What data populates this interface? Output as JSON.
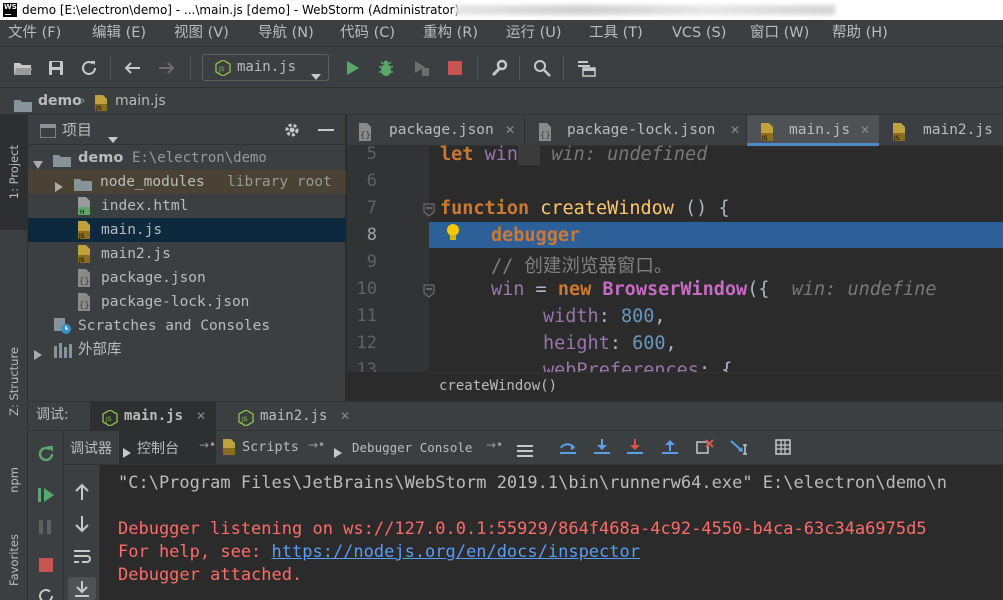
{
  "window": {
    "title": "demo [E:\\electron\\demo] - ...\\main.js [demo] - WebStorm (Administrator)",
    "app_icon": "WS"
  },
  "menu": [
    "文件 (F)",
    "编辑 (E)",
    "视图 (V)",
    "导航 (N)",
    "代码 (C)",
    "重构 (R)",
    "运行 (U)",
    "工具 (T)",
    "VCS (S)",
    "窗口 (W)",
    "帮助 (H)"
  ],
  "toolbar": {
    "run_config": "main.js"
  },
  "navbar": {
    "project": "demo",
    "file": "main.js"
  },
  "side_tabs": {
    "project": "1: Project",
    "structure": "Z: Structure",
    "npm": "npm",
    "favorites": "Favorites"
  },
  "project_panel": {
    "title": "项目",
    "root": {
      "name": "demo",
      "path": "E:\\electron\\demo"
    },
    "node_modules": {
      "name": "node_modules",
      "note": "library root"
    },
    "files": [
      "index.html",
      "main.js",
      "main2.js",
      "package.json",
      "package-lock.json"
    ],
    "scratches": "Scratches and Consoles",
    "external": "外部库"
  },
  "editor": {
    "tabs": [
      "package.json",
      "package-lock.json",
      "main.js",
      "main2.js"
    ],
    "lines": {
      "n5": "5",
      "n6": "6",
      "n7": "7",
      "n8": "8",
      "n9": "9",
      "n10": "10",
      "n11": "11",
      "n12": "12",
      "n13": "13"
    },
    "code": {
      "l5_kw": "let",
      "l5_var": "win",
      "l5_hint": "win: undefined",
      "l7_kw": "function",
      "l7_fn": "createWindow",
      "l7_rest": " () {",
      "l8_kw": "debugger",
      "l9_comment": "// 创建浏览器窗口。",
      "l10_var": "win",
      "l10_op": " = ",
      "l10_kw": "new",
      "l10_cls": "BrowserWindow",
      "l10_rest": "({",
      "l10_hint": "win: undefine",
      "l11_key": "width",
      "l11_val": "800",
      "l12_key": "height",
      "l12_val": "600",
      "l13_key": "webPreferences",
      "l13_rest": ": {"
    },
    "breadcrumb": "createWindow()"
  },
  "debug": {
    "label": "调试:",
    "tabs": [
      "main.js",
      "main2.js"
    ],
    "subtabs": {
      "debugger": "调试器",
      "console": "控制台",
      "scripts": "Scripts",
      "debugger_console": "Debugger Console"
    },
    "console": {
      "cmd": "\"C:\\Program Files\\JetBrains\\WebStorm 2019.1\\bin\\runnerw64.exe\" E:\\electron\\demo\\n",
      "listening": "Debugger listening on ws://127.0.0.1:55929/864f468a-4c92-4550-b4ca-63c34a6975d5",
      "help_prefix": "For help, see: ",
      "help_link": "https://nodejs.org/en/docs/inspector",
      "attached": "Debugger attached."
    }
  },
  "colors": {
    "accent": "#2d6099",
    "error": "#ff6b68",
    "link": "#589df6",
    "run": "#59a869",
    "stop": "#c75450"
  }
}
